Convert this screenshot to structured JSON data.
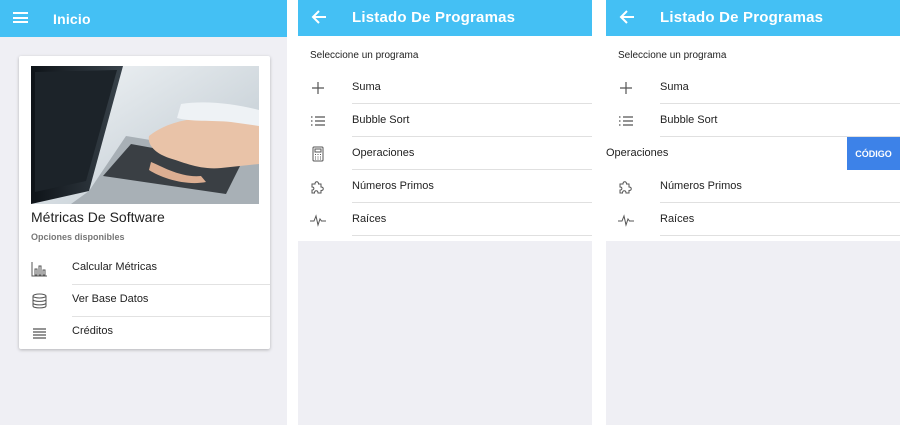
{
  "screen1": {
    "appbar": {
      "title": "Inicio",
      "menu_icon": "menu-icon"
    },
    "card": {
      "image": "laptop-typing-photo",
      "title": "Métricas De Software",
      "subtitle": "Opciones disponibles",
      "options": [
        {
          "label": "Calcular Métricas",
          "icon": "bar-chart-icon"
        },
        {
          "label": "Ver Base Datos",
          "icon": "database-icon"
        },
        {
          "label": "Créditos",
          "icon": "list-lines-icon"
        }
      ]
    }
  },
  "screen2": {
    "appbar": {
      "title": "Listado De Programas",
      "back_icon": "arrow-back-icon"
    },
    "subheader": "Seleccione un programa",
    "items": [
      {
        "label": "Suma",
        "icon": "plus-icon"
      },
      {
        "label": "Bubble Sort",
        "icon": "list-bullets-icon"
      },
      {
        "label": "Operaciones",
        "icon": "calculator-icon"
      },
      {
        "label": "Números Primos",
        "icon": "puzzle-icon"
      },
      {
        "label": "Raíces",
        "icon": "pulse-icon"
      }
    ]
  },
  "screen3": {
    "appbar": {
      "title": "Listado De Programas",
      "back_icon": "arrow-back-icon"
    },
    "subheader": "Seleccione un programa",
    "items": [
      {
        "label": "Suma",
        "icon": "plus-icon"
      },
      {
        "label": "Bubble Sort",
        "icon": "list-bullets-icon"
      },
      {
        "label": "Operaciones",
        "icon": "calculator-icon",
        "swiped": true,
        "action_label": "CÓDIGO"
      },
      {
        "label": "Números Primos",
        "icon": "puzzle-icon"
      },
      {
        "label": "Raíces",
        "icon": "pulse-icon"
      }
    ]
  },
  "colors": {
    "appbar": "#44c0f4",
    "action_button": "#3d82e8",
    "background": "#efeff4"
  }
}
